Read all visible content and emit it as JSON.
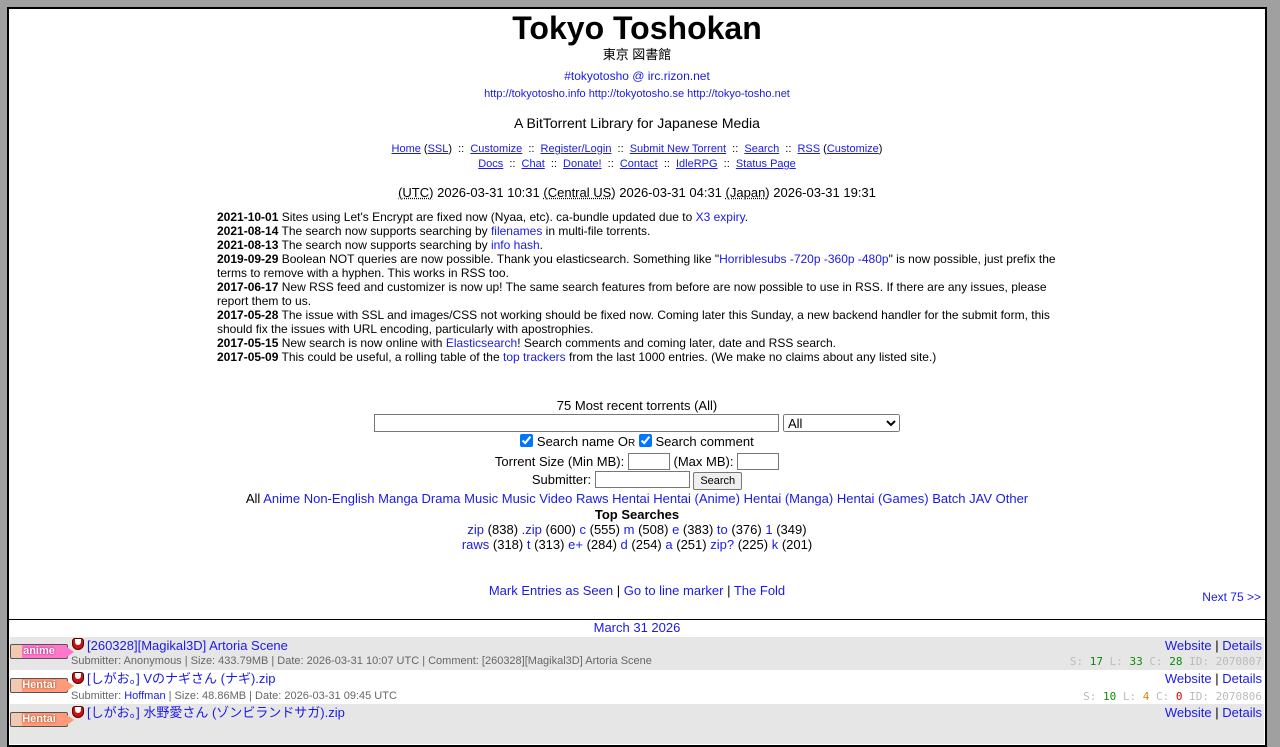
{
  "header": {
    "title": "Tokyo Toshokan",
    "subtitle_jp": "東京 図書館",
    "irc": "#tokyotosho @ irc.rizon.net",
    "mirrors": [
      "http://tokyotosho.info",
      "http://tokyotosho.se",
      "http://tokyo-tosho.net"
    ],
    "tagline": "A BitTorrent Library for Japanese Media"
  },
  "nav": {
    "home": "Home",
    "ssl": "SSL",
    "customize": "Customize",
    "register": "Register/Login",
    "submit": "Submit New Torrent",
    "search": "Search",
    "rss": "RSS",
    "rss_customize": "Customize",
    "docs": "Docs",
    "chat": "Chat",
    "donate": "Donate!",
    "contact": "Contact",
    "idlerpg": "IdleRPG",
    "status": "Status Page",
    "separator": "::"
  },
  "times": {
    "utc_label": "(UTC)",
    "utc": "2026-03-31 10:31",
    "central_label": "(Central US)",
    "central": "2026-03-31 04:31",
    "japan_label": "(Japan)",
    "japan": "2026-03-31 19:31"
  },
  "news": [
    {
      "date": "2021-10-01",
      "pre": "Sites using Let's Encrypt are fixed now (Nyaa, etc). ca-bundle updated due to ",
      "link": "X3 expiry",
      "post": "."
    },
    {
      "date": "2021-08-14",
      "pre": "The search now supports searching by ",
      "link": "filenames",
      "post": " in multi-file torrents."
    },
    {
      "date": "2021-08-13",
      "pre": "The search now supports searching by ",
      "link": "info hash",
      "post": "."
    },
    {
      "date": "2019-09-29",
      "pre": "Boolean NOT queries are now possible. Thank you elasticsearch. Something like \"",
      "link": "Horriblesubs -720p -360p -480p",
      "post": "\" is now possible, just prefix the terms to remove with a hyphen. This works in RSS too."
    },
    {
      "date": "2017-06-17",
      "pre": "New RSS feed and customizer is now up! The same search features from before are now possible to use in RSS. If there are any issues, please report them to us.",
      "link": "",
      "post": ""
    },
    {
      "date": "2017-05-28",
      "pre": "The issue with SSL and images/CSS not working should be fixed now. Coming later this Sunday, a new backend handler for the submit form, this should fix the issues with URL encoding, particularly with apostrophies.",
      "link": "",
      "post": ""
    },
    {
      "date": "2017-05-15",
      "pre": "New search is now online with ",
      "link": "Elasticsearch",
      "post": "! Search comments and coming later, date and RSS search."
    },
    {
      "date": "2017-05-09",
      "pre": "This could be useful, a rolling table of the ",
      "link": "top trackers",
      "post": " from the last 1000 entries. (We make no claims about any listed site.)"
    }
  ],
  "search": {
    "recent_title": "75 Most recent torrents (All)",
    "query_value": "",
    "category_selected": "All",
    "search_name_label": "Search name O",
    "search_name_smallcaps": "R",
    "search_comment_label": "Search comment",
    "size_label": "Torrent Size (Min MB):",
    "max_label": "(Max MB):",
    "submitter_label": "Submitter:",
    "button": "Search"
  },
  "categories": {
    "all": "All",
    "items": [
      "Anime",
      "Non-English",
      "Manga",
      "Drama",
      "Music",
      "Music Video",
      "Raws",
      "Hentai",
      "Hentai (Anime)",
      "Hentai (Manga)",
      "Hentai (Games)",
      "Batch",
      "JAV",
      "Other"
    ]
  },
  "top_searches": {
    "title": "Top Searches",
    "row1": [
      {
        "term": "zip",
        "count": "(838)"
      },
      {
        "term": ".zip",
        "count": "(600)"
      },
      {
        "term": "c",
        "count": "(555)"
      },
      {
        "term": "m",
        "count": "(508)"
      },
      {
        "term": "e",
        "count": "(383)"
      },
      {
        "term": "to",
        "count": "(376)"
      },
      {
        "term": "1",
        "count": "(349)"
      }
    ],
    "row2": [
      {
        "term": "raws",
        "count": "(318)"
      },
      {
        "term": "t",
        "count": "(313)"
      },
      {
        "term": "e+",
        "count": "(284)"
      },
      {
        "term": "d",
        "count": "(254)"
      },
      {
        "term": "a",
        "count": "(251)"
      },
      {
        "term": "zip?",
        "count": "(225)"
      },
      {
        "term": "k",
        "count": "(201)"
      }
    ]
  },
  "marks": {
    "seen": "Mark Entries as Seen",
    "line_marker": "Go to line marker",
    "fold": "The Fold",
    "divider": "|",
    "next": "Next 75 >>"
  },
  "listing": {
    "date": "March 31 2026",
    "rows": [
      {
        "category": "anime",
        "name": "[260328][Magikal3D] Artoria Scene",
        "website": "Website",
        "details": "Details",
        "divider": "|",
        "submitter_label": "Submitter:",
        "submitter": "Anonymous",
        "submitter_linked": false,
        "info": " | Size: 433.79MB | Date: 2026-03-31 10:07 UTC | Comment: [260328][Magikal3D] Artoria Scene",
        "s_label": "S:",
        "s": "17",
        "l_label": "L:",
        "l": "33",
        "c_label": "C:",
        "c": "28",
        "id_label": "ID:",
        "id": "2070807"
      },
      {
        "category": "Hentai",
        "name": "[しがお。] Vのナギさん (ナギ).zip",
        "website": "Website",
        "details": "Details",
        "divider": "|",
        "submitter_label": "Submitter:",
        "submitter": "Hoffman",
        "submitter_linked": true,
        "info": " | Size: 48.86MB | Date: 2026-03-31 09:45 UTC",
        "s_label": "S:",
        "s": "10",
        "l_label": "L:",
        "l": "4",
        "c_label": "C:",
        "c": "0",
        "id_label": "ID:",
        "id": "2070806"
      },
      {
        "category": "Hentai",
        "name": "[しがお。] 水野愛さん (ゾンビランドサガ).zip",
        "website": "Website",
        "details": "Details",
        "divider": "|"
      }
    ]
  },
  "colors": {
    "link": "#1a1ae6",
    "row_shade": "#e6e6e6",
    "frame": "#a0a0a0"
  }
}
